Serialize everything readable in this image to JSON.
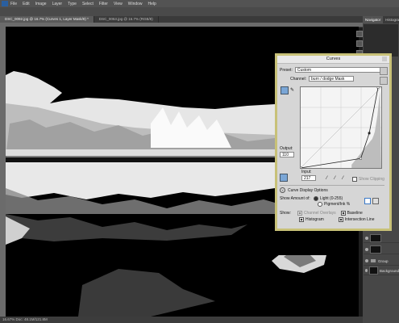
{
  "menubar": {
    "items": [
      "File",
      "Edit",
      "Image",
      "Layer",
      "Type",
      "Select",
      "Filter",
      "View",
      "Window",
      "Help"
    ]
  },
  "tabs": [
    {
      "label": "DSC_0092.jpg @ 16.7% (Curves 1, Layer Mask/8) *",
      "active": true
    },
    {
      "label": "DSC_0053.jpg @ 16.7% (RGB/8)",
      "active": false
    }
  ],
  "statusbar": {
    "text": "16.67%   Doc: 48.1M/121.8M"
  },
  "right_panel": {
    "tabs": [
      "Navigator",
      "Histogram"
    ],
    "layers": [
      "",
      "",
      "Group",
      "Background"
    ]
  },
  "curves": {
    "title": "Curves",
    "preset_label": "Preset:",
    "preset_value": "Custom",
    "channel_label": "Channel:",
    "channel_value": "burn / dodge Mask",
    "output_label": "Output:",
    "output_value": "110",
    "input_label": "Input:",
    "input_value": "217",
    "show_clipping": "Show Clipping",
    "display_options": "Curve Display Options",
    "show_amount_label": "Show Amount of:",
    "light_option": "Light  (0-255)",
    "pigment_option": "Pigment/Ink %",
    "show_label": "Show:",
    "channel_overlays": "Channel Overlays",
    "baseline": "Baseline",
    "histogram": "Histogram",
    "intersection_line": "Intersection Line",
    "curve_points": [
      [
        0,
        0
      ],
      [
        190,
        30
      ],
      [
        217,
        110
      ],
      [
        245,
        255
      ]
    ],
    "histogram_peaks": [
      4,
      6,
      8,
      10,
      12,
      14,
      16,
      18,
      20,
      22,
      24,
      26,
      28,
      30,
      32,
      34,
      36,
      40,
      45,
      55,
      65,
      80,
      95
    ]
  },
  "colors": {
    "dialog_border": "#c8c178",
    "ps_panel": "#474747"
  }
}
